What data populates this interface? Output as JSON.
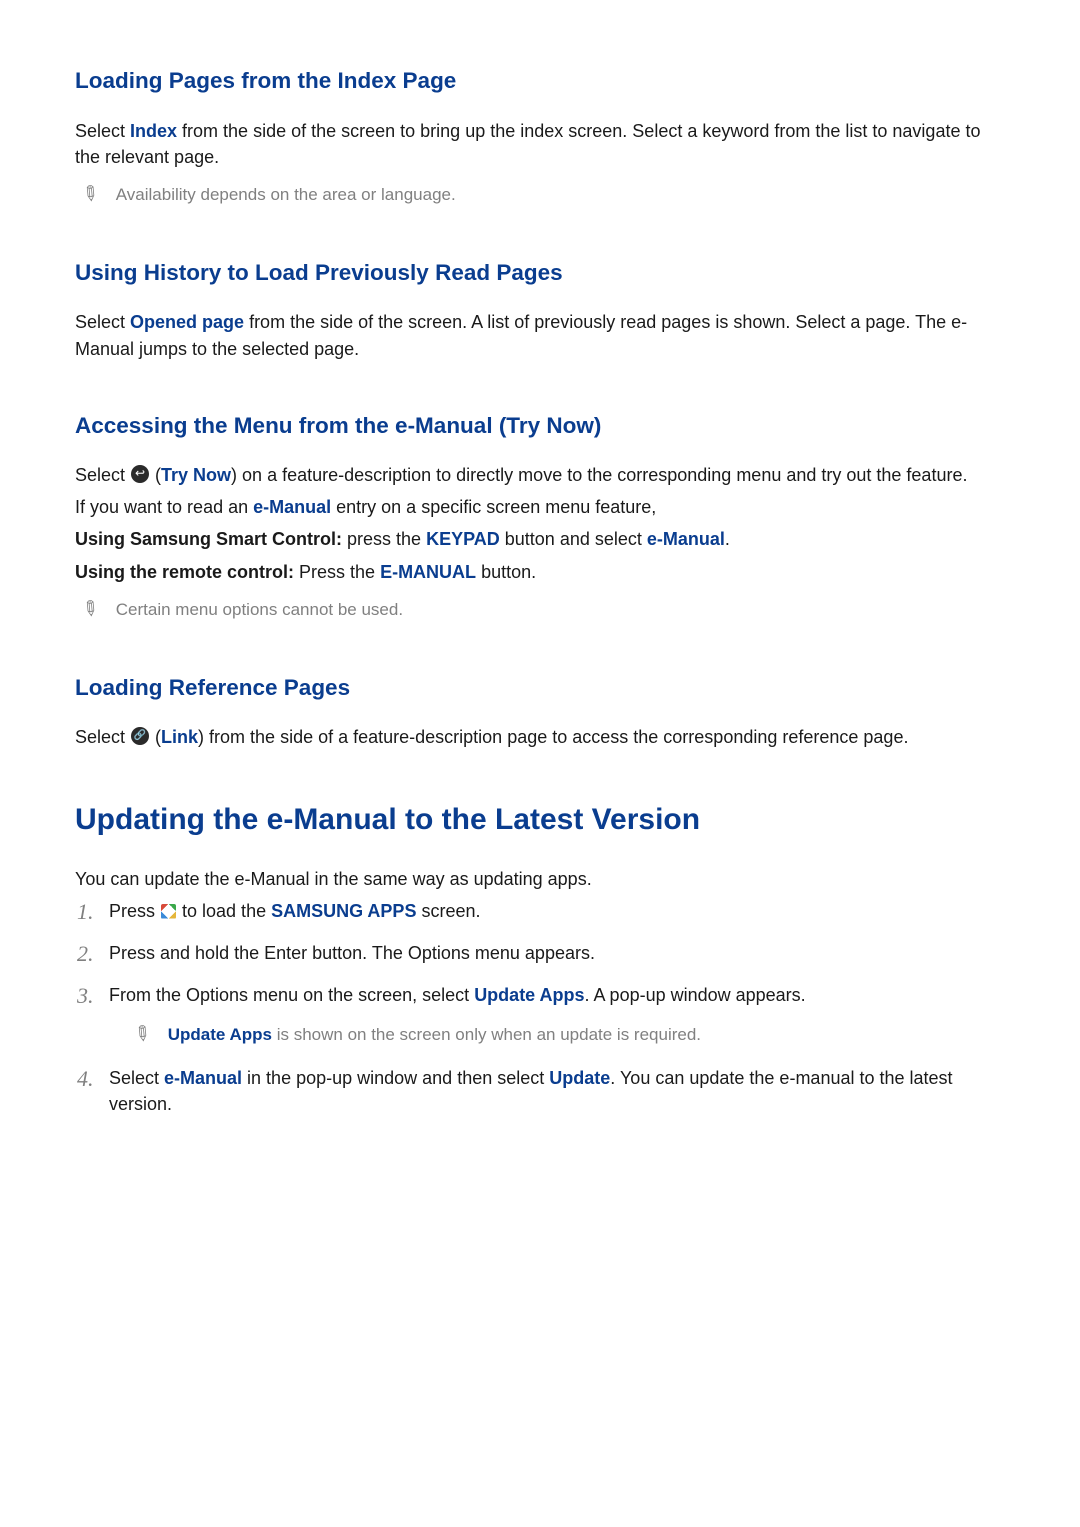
{
  "s1": {
    "heading": "Loading Pages from the Index Page",
    "p1_a": "Select ",
    "p1_index": "Index",
    "p1_b": " from the side of the screen to bring up the index screen. Select a keyword from the list to navigate to the relevant page.",
    "note": "Availability depends on the area or language."
  },
  "s2": {
    "heading": "Using History to Load Previously Read Pages",
    "p1_a": "Select ",
    "p1_opened": "Opened page",
    "p1_b": " from the side of the screen. A list of previously read pages is shown. Select a page. The e-Manual jumps to the selected page."
  },
  "s3": {
    "heading": "Accessing the Menu from the e-Manual (Try Now)",
    "p1_a": "Select ",
    "p1_try_open": " (",
    "p1_try": "Try Now",
    "p1_try_close": ") on a feature-description to directly move to the corresponding menu and try out the feature.",
    "p2_a": "If you want to read an ",
    "p2_em": "e-Manual",
    "p2_b": " entry on a specific screen menu feature,",
    "p3_strong": "Using Samsung Smart Control:",
    "p3_a": " press the ",
    "p3_keypad": "KEYPAD",
    "p3_b": " button and select ",
    "p3_em": "e-Manual",
    "p3_c": ".",
    "p4_strong": "Using the remote control:",
    "p4_a": " Press the ",
    "p4_emanual": "E-MANUAL",
    "p4_b": " button.",
    "note": "Certain menu options cannot be used."
  },
  "s4": {
    "heading": "Loading Reference Pages",
    "p1_a": "Select ",
    "p1_link_open": " (",
    "p1_link": "Link",
    "p1_link_close": ") from the side of a feature-description page to access the corresponding reference page."
  },
  "h1": "Updating the e-Manual to the Latest Version",
  "intro": "You can update the e-Manual in the same way as updating apps.",
  "steps": {
    "s1a": "Press ",
    "s1b": " to load the ",
    "s1_apps": "SAMSUNG APPS",
    "s1c": " screen.",
    "s2": "Press and hold the Enter button. The Options menu appears.",
    "s3a": "From the Options menu on the screen, select ",
    "s3_update": "Update Apps",
    "s3b": ". A pop-up window appears.",
    "note_hl": "Update Apps",
    "note_rest": " is shown on the screen only when an update is required.",
    "s4a": "Select ",
    "s4_em": "e-Manual",
    "s4b": " in the pop-up window and then select ",
    "s4_update": "Update",
    "s4c": ". You can update the e-manual to the latest version."
  }
}
